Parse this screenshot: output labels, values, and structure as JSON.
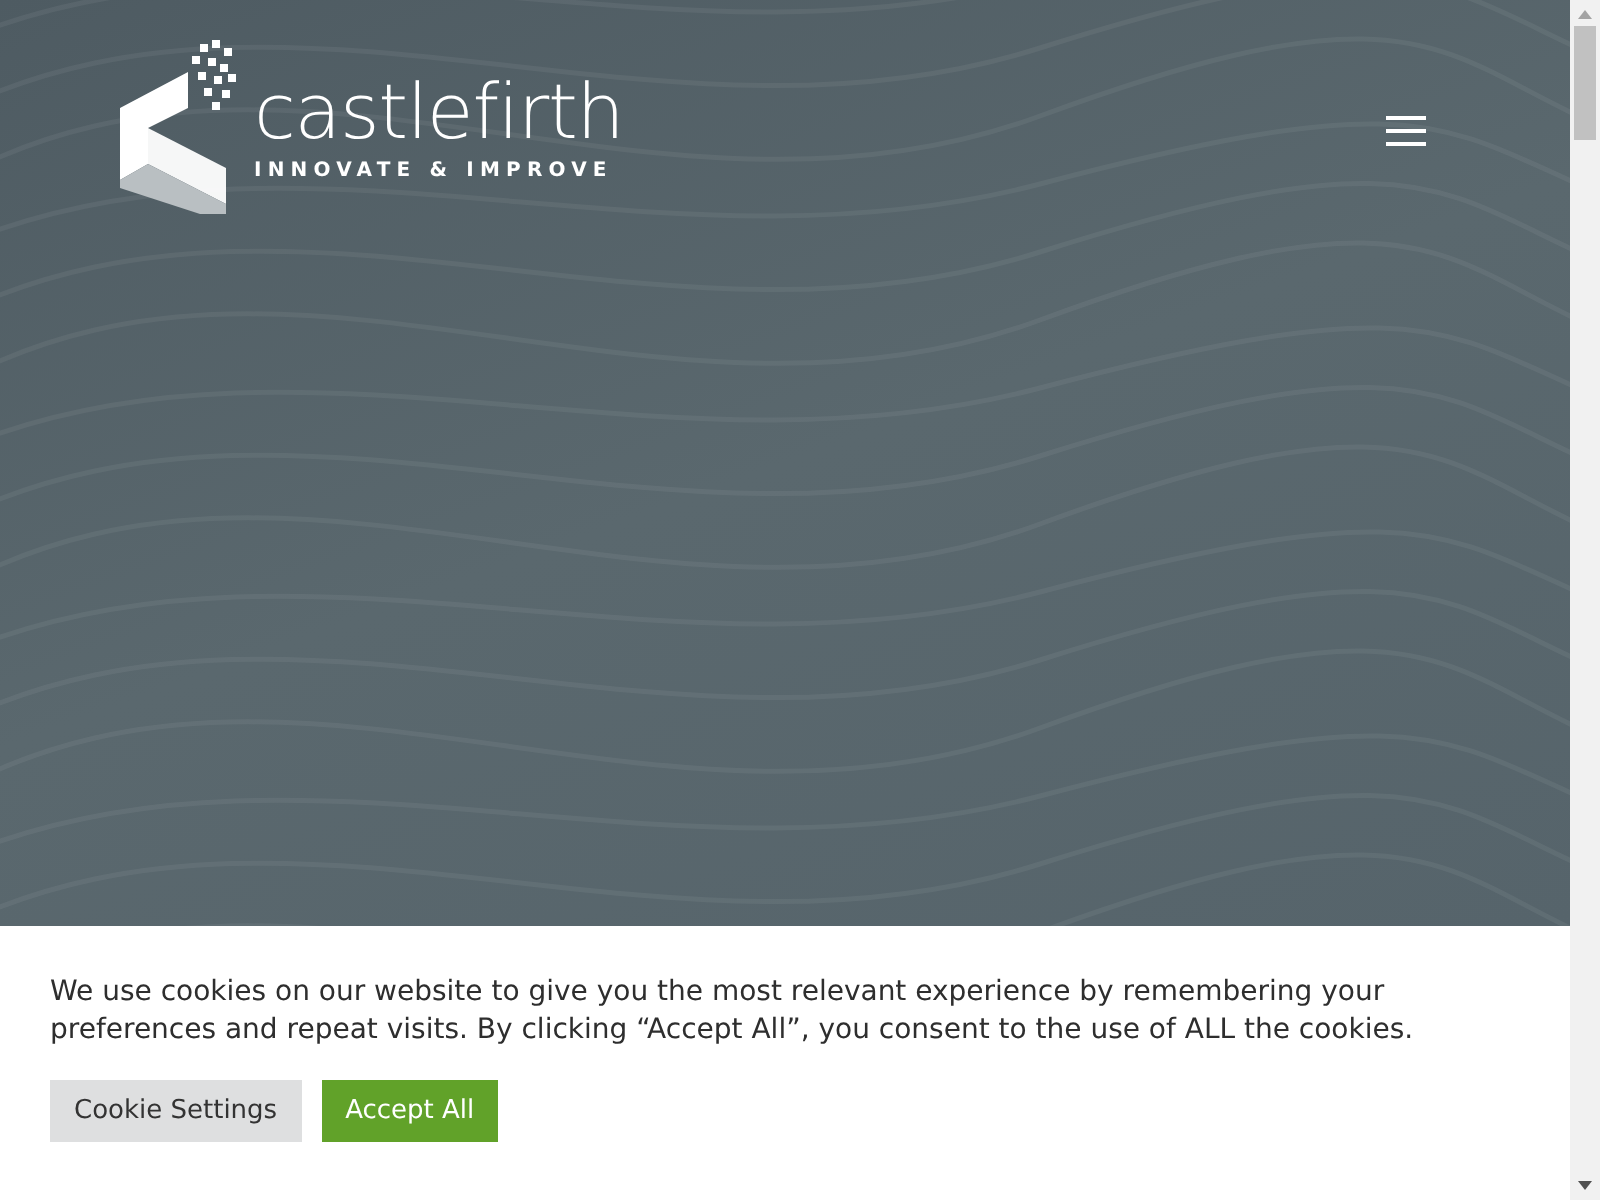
{
  "header": {
    "logo": {
      "name": "castlefirth",
      "tagline": "INNOVATE & IMPROVE"
    }
  },
  "cookie_banner": {
    "message": "We use cookies on our website to give you the most relevant experience by remembering your preferences and repeat visits. By clicking “Accept All”, you consent to the use of ALL the cookies.",
    "buttons": [
      {
        "label": "Cookie Settings",
        "kind": "secondary"
      },
      {
        "label": "Accept All",
        "kind": "primary"
      }
    ]
  }
}
